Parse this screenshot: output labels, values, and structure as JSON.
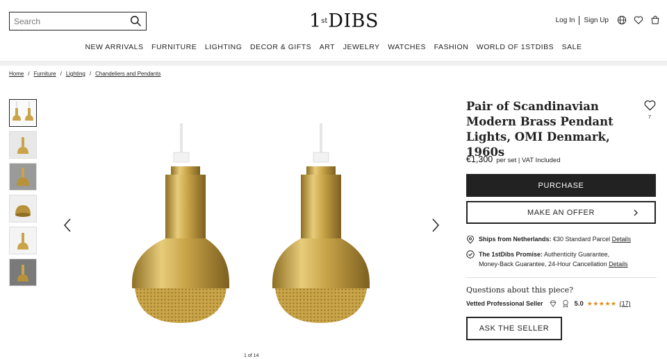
{
  "header": {
    "search_placeholder": "Search",
    "logo": {
      "one": "1",
      "st": "st",
      "dibs": "DIBS"
    },
    "login": "Log In",
    "signup": "Sign Up"
  },
  "nav": [
    "NEW ARRIVALS",
    "FURNITURE",
    "LIGHTING",
    "DECOR & GIFTS",
    "ART",
    "JEWELRY",
    "WATCHES",
    "FASHION",
    "WORLD OF 1STDIBS",
    "SALE"
  ],
  "breadcrumb": [
    "Home",
    "Furniture",
    "Lighting",
    "Chandeliers and Pendants"
  ],
  "gallery": {
    "pagination": "1 of 14",
    "thumb_count": 6
  },
  "product": {
    "title": "Pair of Scandinavian Modern Brass Pendant Lights, OMI Denmark, 1960s",
    "favorite_count": "7",
    "price": "€1,300",
    "price_note": "per set | VAT Included",
    "purchase_label": "PURCHASE",
    "offer_label": "MAKE AN OFFER"
  },
  "shipping": {
    "label": "Ships from Netherlands:",
    "detail": "€30 Standard Parcel",
    "link": "Details"
  },
  "promise": {
    "label": "The 1stDibs Promise:",
    "detail_line1": "Authenticity Guarantee,",
    "detail_line2": "Money-Back Guarantee, 24-Hour Cancellation",
    "link": "Details"
  },
  "seller": {
    "questions": "Questions about this piece?",
    "vetted": "Vetted Professional Seller",
    "rating": "5.0",
    "stars": "★★★★★",
    "reviews": "(17)",
    "ask_label": "ASK THE SELLER"
  },
  "colors": {
    "brass": "#c9a448",
    "brass_dark": "#8e6f24",
    "star": "#e08a14",
    "primary": "#222222"
  }
}
